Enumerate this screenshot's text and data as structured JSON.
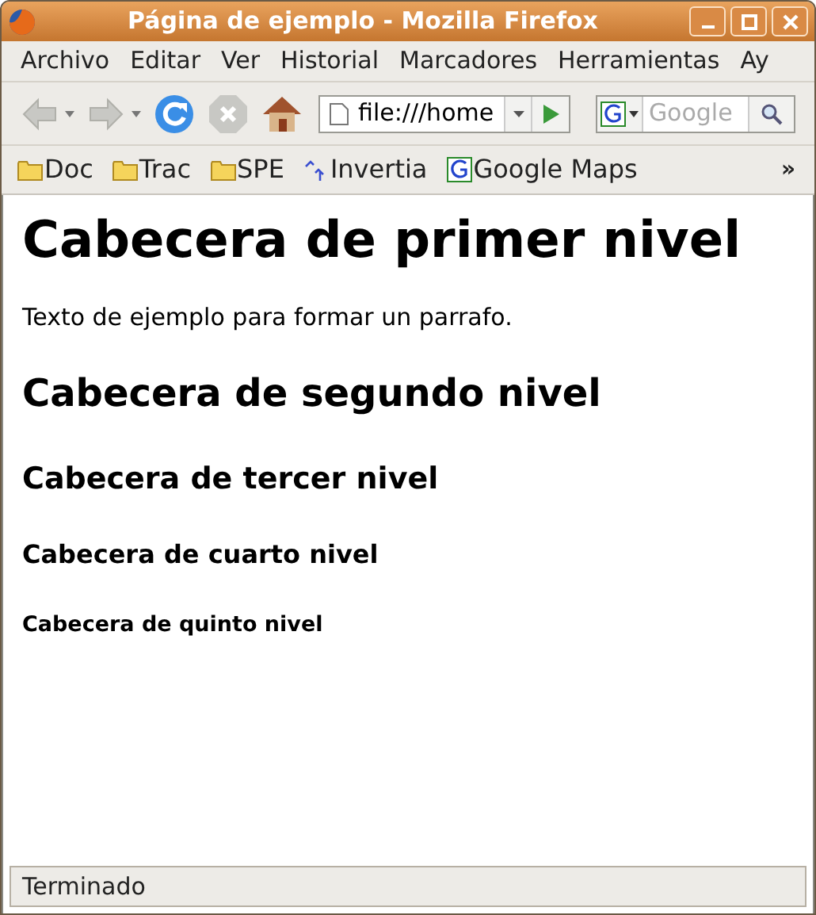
{
  "window": {
    "title": "Página de ejemplo - Mozilla Firefox"
  },
  "menu": [
    "Archivo",
    "Editar",
    "Ver",
    "Historial",
    "Marcadores",
    "Herramientas",
    "Ay"
  ],
  "toolbar": {
    "buttons": [
      {
        "kind": "back",
        "disabled": true
      },
      {
        "kind": "forward",
        "disabled": true
      },
      {
        "kind": "reload",
        "disabled": false
      },
      {
        "kind": "stop",
        "disabled": true
      },
      {
        "kind": "home",
        "disabled": false
      }
    ],
    "url": "file:///home",
    "search_placeholder": "Google"
  },
  "bookmarks": [
    {
      "kind": "folder",
      "label": "Doc"
    },
    {
      "kind": "folder",
      "label": "Trac"
    },
    {
      "kind": "folder",
      "label": "SPE"
    },
    {
      "kind": "site",
      "label": "Invertia"
    },
    {
      "kind": "google",
      "label": "Google Maps"
    }
  ],
  "bookmarks_overflow": "»",
  "page": [
    {
      "kind": "h1",
      "text": "Cabecera de primer nivel"
    },
    {
      "kind": "p",
      "text": "Texto de ejemplo para formar un parrafo."
    },
    {
      "kind": "h2",
      "text": "Cabecera de segundo nivel"
    },
    {
      "kind": "h3",
      "text": "Cabecera de tercer nivel"
    },
    {
      "kind": "h4",
      "text": "Cabecera de cuarto nivel"
    },
    {
      "kind": "h5",
      "text": "Cabecera de quinto nivel"
    }
  ],
  "status_bar": "Terminado"
}
